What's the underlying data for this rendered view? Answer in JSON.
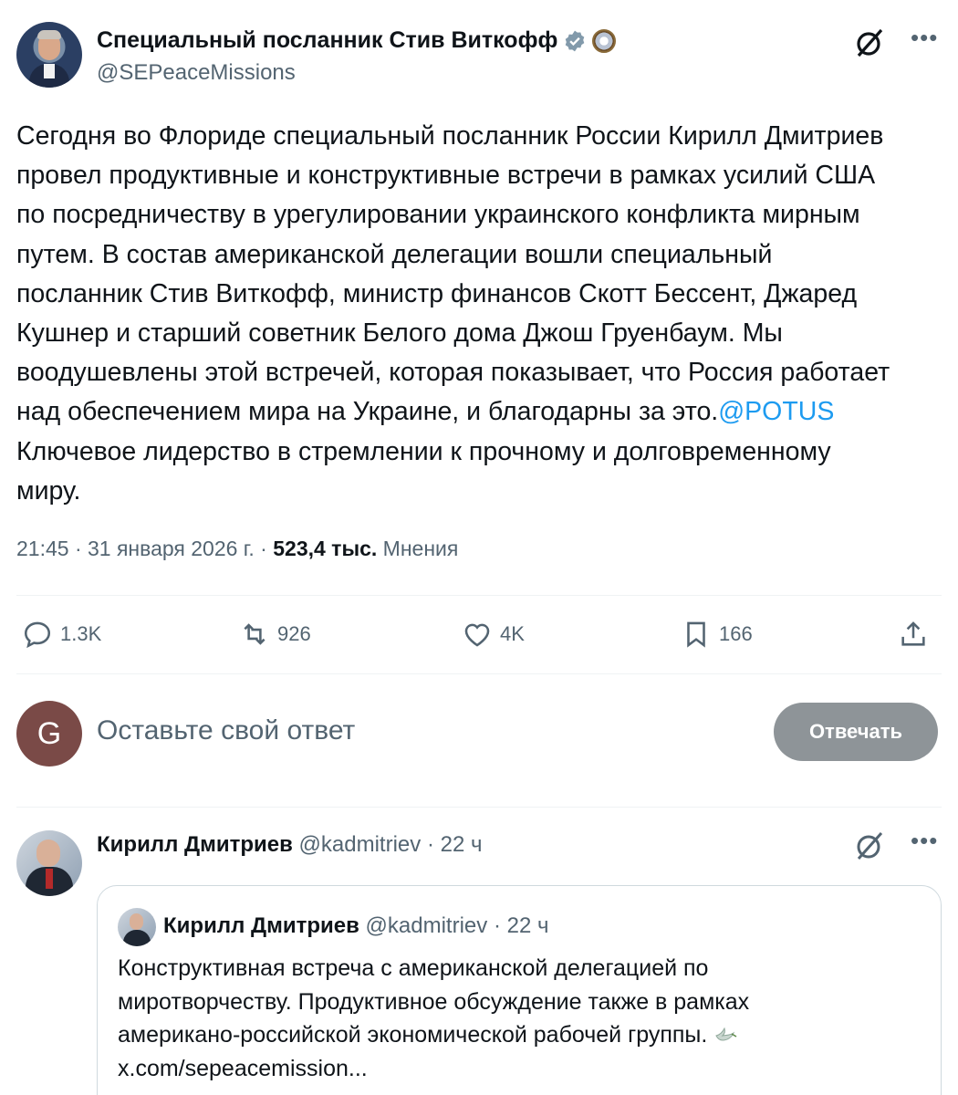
{
  "post": {
    "author_name": "Специальный посланник Стив Виткофф",
    "author_handle": "@SEPeaceMissions",
    "text": "Сегодня во Флориде специальный посланник России Кирилл Дмитриев\nпровел продуктивные и конструктивные встречи в рамках усилий США\nпо посредничеству в урегулировании украинского конфликта мирным\nпутем. В состав американской делегации вошли специальный\nпосланник Стив Виткофф, министр финансов Скотт Бессент, Джаред\nКушнер и старший советник Белого дома Джош Груенбаум. Мы\nвоодушевлены этой встречей, которая показывает, что Россия работает\nнад обеспечением мира на Украине, и благодарны за это.",
    "mention": "@POTUS",
    "text_after": "\nКлючевое лидерство в стремлении к прочному и долговременному\nмиру.",
    "time": "21:45 · 31 января 2026 г. · ",
    "views_count": "523,4 тыс.",
    "views_label": "Мнения"
  },
  "actions": {
    "replies": "1.3K",
    "reposts": "926",
    "likes": "4K",
    "bookmarks": "166"
  },
  "reply_composer": {
    "avatar_letter": "G",
    "placeholder": "Оставьте свой ответ",
    "button_label": "Отвечать"
  },
  "reply": {
    "author_name": "Кирилл Дмитриев",
    "author_handle": "@kadmitriev",
    "time": "· 22 ч",
    "quote": {
      "author_name": "Кирилл Дмитриев",
      "author_handle": "@kadmitriev",
      "time": "· 22 ч",
      "text": "Конструктивная встреча с американской делегацией по\nмиротворчеству. Продуктивное обсуждение также в рамках\nамерикано-российской экономической рабочей группы.",
      "link": "x.com/sepeacemission..."
    }
  },
  "colors": {
    "accent": "#1d9bf0",
    "secondary_text": "#536471",
    "reply_button": "#8e9498",
    "composer_avatar": "#7a4a47"
  },
  "icons": [
    "verified-badge-icon",
    "state-seal-icon",
    "grok-icon",
    "more-icon",
    "reply-icon",
    "repost-icon",
    "like-icon",
    "bookmark-icon",
    "share-icon",
    "dove-icon"
  ]
}
